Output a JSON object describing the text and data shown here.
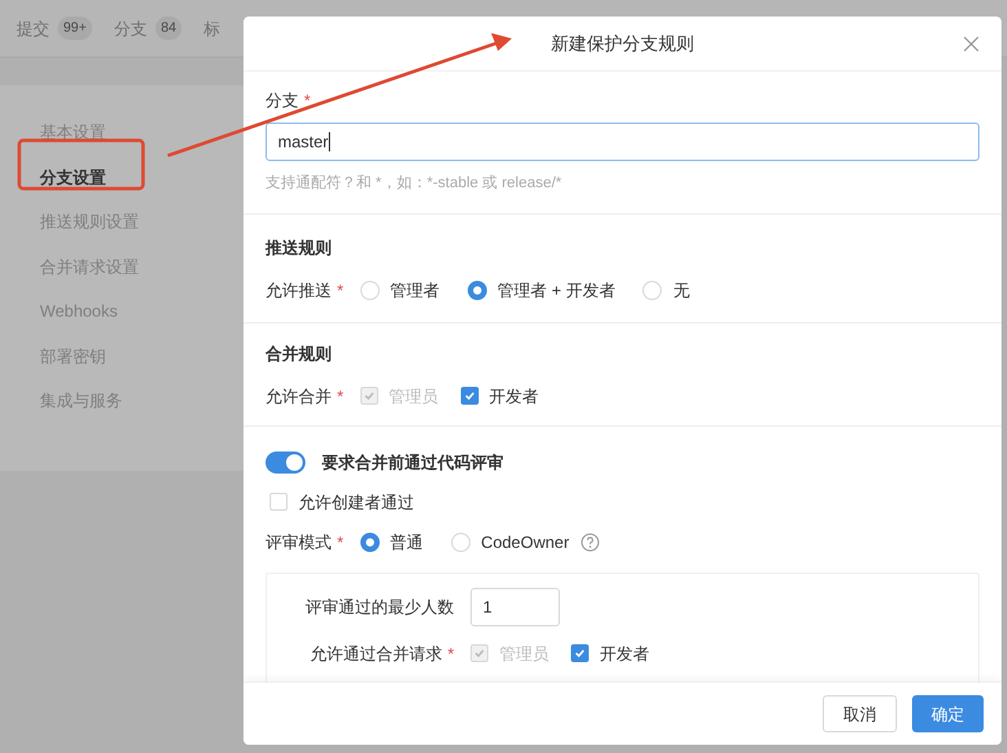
{
  "background": {
    "tabs": [
      {
        "label": "提交",
        "count": "99+"
      },
      {
        "label": "分支",
        "count": "84"
      },
      {
        "label": "标"
      }
    ],
    "sidebar": {
      "items": [
        {
          "label": "基本设置",
          "selected": false
        },
        {
          "label": "分支设置",
          "selected": true
        },
        {
          "label": "推送规则设置",
          "selected": false
        },
        {
          "label": "合并请求设置",
          "selected": false
        },
        {
          "label": "Webhooks",
          "selected": false
        },
        {
          "label": "部署密钥",
          "selected": false
        },
        {
          "label": "集成与服务",
          "selected": false
        }
      ]
    }
  },
  "dialog": {
    "title": "新建保护分支规则",
    "branch": {
      "label": "分支",
      "mark": "*",
      "value": "master",
      "hint": "支持通配符？和 *，如：*-stable 或 release/*"
    },
    "push_rules": {
      "title": "推送规则",
      "label": "允许推送",
      "mark": "*",
      "options": [
        {
          "label": "管理者",
          "selected": false
        },
        {
          "label": "管理者 + 开发者",
          "selected": true
        },
        {
          "label": "无",
          "selected": false
        }
      ]
    },
    "merge_rules": {
      "title": "合并规则",
      "label": "允许合并",
      "mark": "*",
      "options": [
        {
          "label": "管理员",
          "checked": true,
          "disabled": true
        },
        {
          "label": "开发者",
          "checked": true,
          "disabled": false
        }
      ]
    },
    "review": {
      "toggle": {
        "label": "要求合并前通过代码评审",
        "on": true
      },
      "allow_creator": {
        "label": "允许创建者通过",
        "checked": false
      },
      "mode": {
        "label": "评审模式",
        "mark": "*",
        "options": [
          {
            "label": "普通",
            "selected": true
          },
          {
            "label": "CodeOwner",
            "selected": false
          }
        ]
      },
      "min_reviewers": {
        "label": "评审通过的最少人数",
        "value": "1"
      },
      "allow_pass": {
        "label": "允许通过合并请求",
        "mark": "*",
        "options": [
          {
            "label": "管理员",
            "checked": true,
            "disabled": true
          },
          {
            "label": "开发者",
            "checked": true,
            "disabled": false
          }
        ]
      }
    },
    "buttons": [
      {
        "label": "取消",
        "kind": "secondary"
      },
      {
        "label": "确定",
        "kind": "primary"
      }
    ]
  }
}
